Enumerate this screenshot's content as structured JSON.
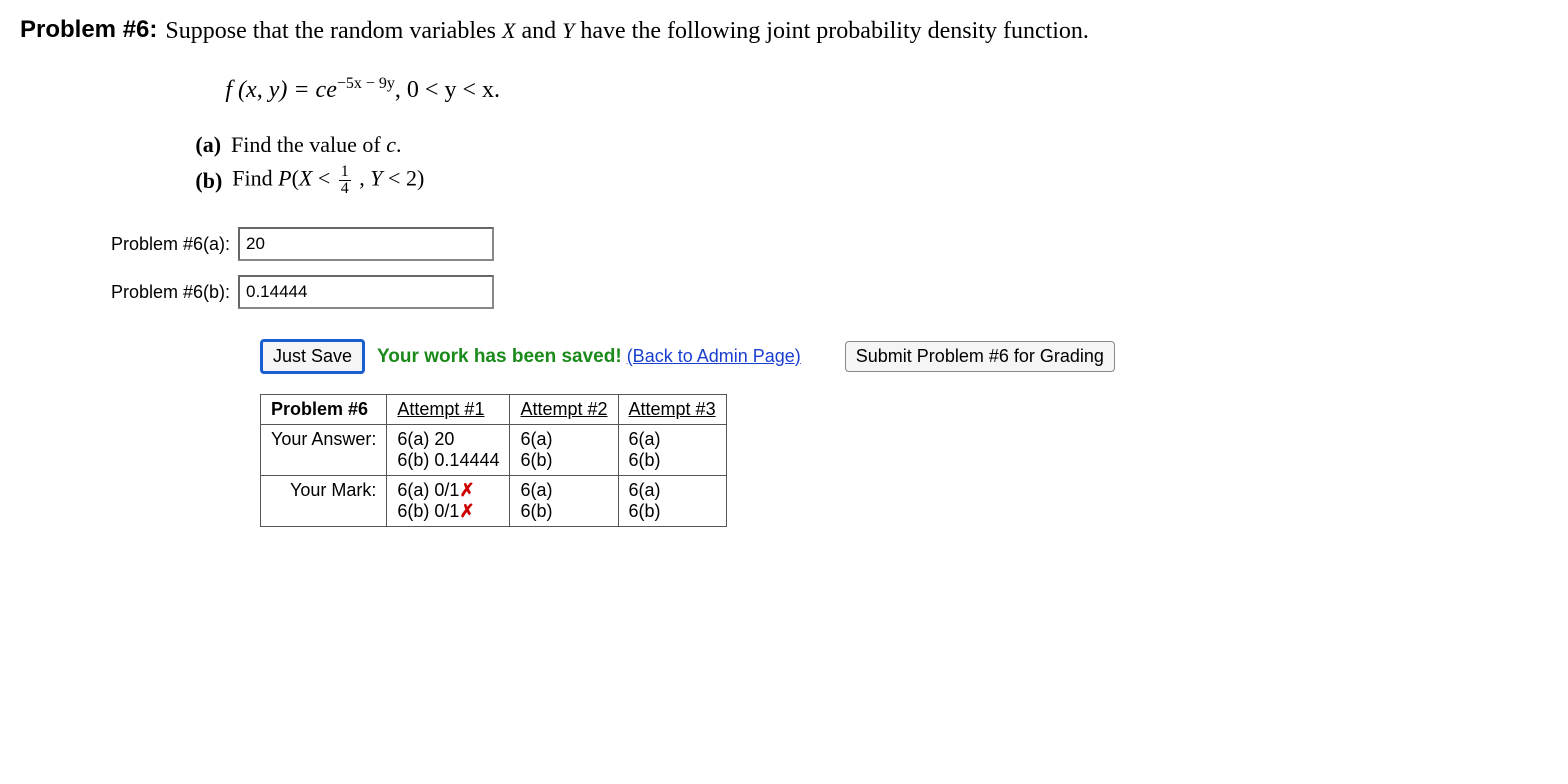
{
  "problem": {
    "label": "Problem #6:",
    "intro_prefix": "Suppose that the random variables ",
    "intro_x": "X",
    "intro_mid": " and ",
    "intro_y": "Y",
    "intro_suffix": " have the following joint probability density function.",
    "equation": {
      "lhs": "f (x, y)  =  ce",
      "exp": "−5x − 9y",
      "rhs": ",    0  <  y  <  x."
    },
    "parts": {
      "a_label": "(a)",
      "a_text_prefix": "Find the value of ",
      "a_text_var": "c",
      "a_text_suffix": ".",
      "b_label": "(b)",
      "b_text_prefix": "Find ",
      "b_text_P": "P",
      "b_text_open": "(",
      "b_text_X": "X",
      "b_text_lt1": "  <  ",
      "b_frac_num": "1",
      "b_frac_den": "4",
      "b_text_comma": " , ",
      "b_text_Y": "Y",
      "b_text_lt2": "  <  2)"
    }
  },
  "answers": {
    "a_label": "Problem #6(a):",
    "a_value": "20",
    "b_label": "Problem #6(b):",
    "b_value": "0.14444"
  },
  "buttons": {
    "just_save": "Just Save",
    "saved_msg": "Your work has been saved!",
    "back_link": "(Back to Admin Page)",
    "submit": "Submit Problem #6 for Grading"
  },
  "table": {
    "header_problem": "Problem #6",
    "header_a1": "Attempt #1",
    "header_a2": "Attempt #2",
    "header_a3": "Attempt #3",
    "row_answer_label": "Your Answer:",
    "row_mark_label": "Your Mark:",
    "ans_a1_line1": "6(a) 20",
    "ans_a1_line2": "6(b) 0.14444",
    "ans_a2_line1": "6(a)",
    "ans_a2_line2": "6(b)",
    "ans_a3_line1": "6(a)",
    "ans_a3_line2": "6(b)",
    "mark_a1_line1_pre": "6(a) 0/1",
    "mark_a1_line2_pre": "6(b) 0/1",
    "mark_x": "✗",
    "mark_a2_line1": "6(a)",
    "mark_a2_line2": "6(b)",
    "mark_a3_line1": "6(a)",
    "mark_a3_line2": "6(b)"
  }
}
